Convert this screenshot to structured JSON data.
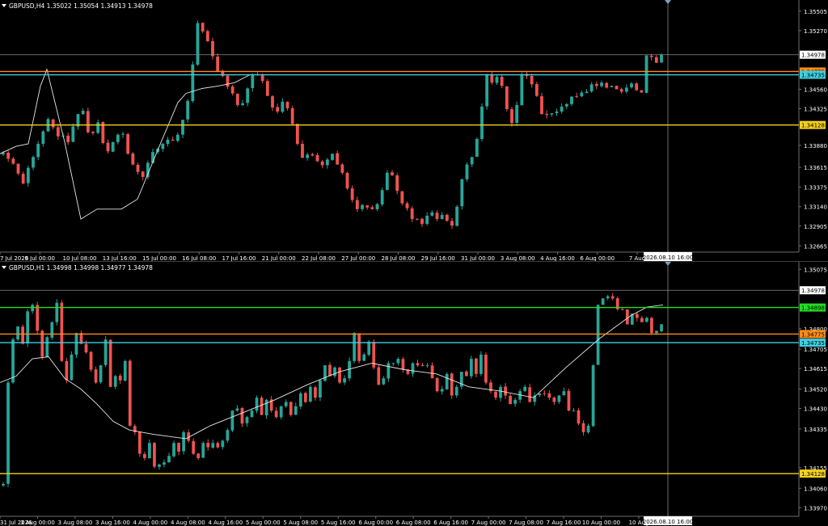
{
  "chart_data": [
    {
      "type": "candlestick",
      "title": "GBPUSD,H4  1.35022 1.35054 1.34913 1.34978",
      "symbol": "GBPUSD",
      "timeframe": "H4",
      "ohlc_readout": [
        "1.35022",
        "1.35054",
        "1.34913",
        "1.34978"
      ],
      "y_ticks": [
        "1.35505",
        "1.35270",
        "1.34560",
        "1.34325",
        "1.33880",
        "1.33615",
        "1.33375",
        "1.33140",
        "1.32905",
        "1.32665"
      ],
      "x_ticks": [
        "7 Jul 2026",
        "9 Jul 00:00",
        "10 Jul 08:00",
        "13 Jul 16:00",
        "15 Jul 00:00",
        "16 Jul 08:00",
        "17 Jul 16:00",
        "21 Jul 00:00",
        "22 Jul 08:00",
        "27 Jul 00:00",
        "28 Jul 08:00",
        "29 Jul 16:00",
        "31 Jul 00:00",
        "3 Aug 08:00",
        "4 Aug 16:00",
        "6 Aug 00:00",
        "7 Aug"
      ],
      "ylim": [
        1.3259,
        1.3564
      ],
      "bar_count": 133,
      "close_series": [
        1.3379,
        1.3372,
        1.3366,
        1.3354,
        1.3342,
        1.3361,
        1.3374,
        1.339,
        1.3405,
        1.342,
        1.341,
        1.3399,
        1.34,
        1.3392,
        1.3411,
        1.3426,
        1.343,
        1.3404,
        1.3403,
        1.3416,
        1.3391,
        1.3381,
        1.3392,
        1.3401,
        1.3402,
        1.3378,
        1.3365,
        1.3356,
        1.335,
        1.3367,
        1.338,
        1.3384,
        1.339,
        1.3395,
        1.3394,
        1.3401,
        1.3419,
        1.3442,
        1.3486,
        1.3536,
        1.3526,
        1.3514,
        1.3496,
        1.3478,
        1.3472,
        1.3459,
        1.3451,
        1.3437,
        1.3439,
        1.3457,
        1.3474,
        1.3473,
        1.3466,
        1.3448,
        1.3434,
        1.3429,
        1.3441,
        1.3433,
        1.3414,
        1.339,
        1.3373,
        1.3377,
        1.3376,
        1.3369,
        1.3364,
        1.3371,
        1.3378,
        1.3365,
        1.3355,
        1.3336,
        1.3322,
        1.3311,
        1.3316,
        1.3313,
        1.3311,
        1.3317,
        1.3334,
        1.3355,
        1.3352,
        1.3333,
        1.3318,
        1.3312,
        1.3299,
        1.3299,
        1.3293,
        1.3303,
        1.3307,
        1.3299,
        1.3304,
        1.3297,
        1.3291,
        1.3314,
        1.3347,
        1.3365,
        1.3374,
        1.3396,
        1.3435,
        1.3474,
        1.3464,
        1.3471,
        1.346,
        1.3432,
        1.3415,
        1.3437,
        1.3474,
        1.3472,
        1.3462,
        1.3448,
        1.3426,
        1.3425,
        1.3427,
        1.3429,
        1.3435,
        1.3438,
        1.3447,
        1.3447,
        1.3452,
        1.3453,
        1.3462,
        1.346,
        1.3464,
        1.3458,
        1.346,
        1.3456,
        1.3453,
        1.3458,
        1.3463,
        1.3455,
        1.3452,
        1.3497,
        1.3495,
        1.3488,
        1.3498
      ],
      "moving_average": [
        [
          0,
          1.3378
        ],
        [
          20,
          1.3387
        ],
        [
          35,
          1.339
        ],
        [
          50,
          1.346
        ],
        [
          58,
          1.348
        ],
        [
          80,
          1.3392
        ],
        [
          100,
          1.3299
        ],
        [
          120,
          1.3311
        ],
        [
          150,
          1.3311
        ],
        [
          170,
          1.3323
        ],
        [
          200,
          1.3394
        ],
        [
          220,
          1.344
        ],
        [
          230,
          1.3451
        ],
        [
          250,
          1.3457
        ],
        [
          270,
          1.346
        ],
        [
          290,
          1.3464
        ],
        [
          310,
          1.3474
        ]
      ],
      "levels": [
        {
          "name": "price-line",
          "value": 1.34978,
          "label": "1.34978",
          "color": "#8a8a8a",
          "label_bg": "#ffffff",
          "label_fg": "#000000"
        },
        {
          "name": "orange-level",
          "value": 1.34775,
          "label": "1.34775",
          "color": "#ff8c1a",
          "label_bg": "#ff8c1a",
          "label_fg": "#000000"
        },
        {
          "name": "cyan-level",
          "value": 1.34735,
          "label": "1.34735",
          "color": "#3ecfe0",
          "label_bg": "#3ecfe0",
          "label_fg": "#000000"
        },
        {
          "name": "yellow-level",
          "value": 1.34128,
          "label": "1.34128",
          "color": "#f2d020",
          "label_bg": "#f2d020",
          "label_fg": "#000000"
        }
      ],
      "crosshair_label": "2026.08.10 16:00"
    },
    {
      "type": "candlestick",
      "title": "GBPUSD,H1  1.34998 1.34998 1.34977 1.34978",
      "symbol": "GBPUSD",
      "timeframe": "H1",
      "ohlc_readout": [
        "1.34998",
        "1.34998",
        "1.34977",
        "1.34978"
      ],
      "y_ticks": [
        "1.35075",
        "1.34800",
        "1.34705",
        "1.34615",
        "1.34520",
        "1.34430",
        "1.34335",
        "1.34155",
        "1.34060",
        "1.33970"
      ],
      "x_ticks": [
        "31 Jul 2026",
        "3 Aug 00:00",
        "3 Aug 08:00",
        "3 Aug 16:00",
        "4 Aug 00:00",
        "4 Aug 08:00",
        "4 Aug 16:00",
        "5 Aug 00:00",
        "5 Aug 08:00",
        "5 Aug 16:00",
        "6 Aug 00:00",
        "6 Aug 08:00",
        "6 Aug 16:00",
        "7 Aug 00:00",
        "7 Aug 08:00",
        "7 Aug 16:00",
        "10 Aug 00:00",
        "10 Aug"
      ],
      "ylim": [
        1.3393,
        1.3511
      ],
      "bar_count": 136,
      "close_series": [
        1.3408,
        1.3455,
        1.3475,
        1.3481,
        1.3473,
        1.3488,
        1.3491,
        1.3479,
        1.3467,
        1.3476,
        1.3483,
        1.3492,
        1.3465,
        1.3456,
        1.3468,
        1.3478,
        1.3473,
        1.3469,
        1.3461,
        1.3455,
        1.3463,
        1.3475,
        1.3453,
        1.3458,
        1.3456,
        1.3465,
        1.3435,
        1.3432,
        1.3422,
        1.342,
        1.3427,
        1.3416,
        1.3417,
        1.3418,
        1.3421,
        1.3427,
        1.3423,
        1.3432,
        1.3428,
        1.3422,
        1.342,
        1.3427,
        1.3425,
        1.3427,
        1.3425,
        1.3428,
        1.3433,
        1.3442,
        1.3443,
        1.3436,
        1.3439,
        1.3442,
        1.3448,
        1.344,
        1.3447,
        1.3442,
        1.3439,
        1.3444,
        1.3446,
        1.344,
        1.3444,
        1.345,
        1.3446,
        1.3453,
        1.3448,
        1.3456,
        1.3463,
        1.3458,
        1.3462,
        1.3455,
        1.3457,
        1.3465,
        1.3478,
        1.3465,
        1.3468,
        1.3474,
        1.3462,
        1.3454,
        1.3457,
        1.3464,
        1.3464,
        1.3466,
        1.3461,
        1.3459,
        1.3464,
        1.3463,
        1.3463,
        1.3463,
        1.3457,
        1.3451,
        1.3452,
        1.3459,
        1.3449,
        1.3453,
        1.346,
        1.3458,
        1.3466,
        1.3459,
        1.3468,
        1.3455,
        1.3451,
        1.3448,
        1.3453,
        1.3449,
        1.3445,
        1.3447,
        1.3451,
        1.3453,
        1.3446,
        1.3449,
        1.345,
        1.345,
        1.3448,
        1.3446,
        1.3449,
        1.3451,
        1.3442,
        1.3442,
        1.3436,
        1.3432,
        1.3435,
        1.3463,
        1.3491,
        1.3494,
        1.3495,
        1.3494,
        1.3489,
        1.3489,
        1.3482,
        1.3487,
        1.3485,
        1.3483,
        1.3485,
        1.3478,
        1.3479,
        1.3482
      ],
      "moving_average": [
        [
          0,
          1.3455
        ],
        [
          20,
          1.3458
        ],
        [
          40,
          1.3466
        ],
        [
          60,
          1.3467
        ],
        [
          80,
          1.3457
        ],
        [
          100,
          1.3452
        ],
        [
          120,
          1.3445
        ],
        [
          140,
          1.3437
        ],
        [
          160,
          1.3433
        ],
        [
          190,
          1.3431
        ],
        [
          230,
          1.3429
        ],
        [
          260,
          1.3435
        ],
        [
          300,
          1.3441
        ],
        [
          340,
          1.3447
        ],
        [
          380,
          1.3454
        ],
        [
          420,
          1.346
        ],
        [
          460,
          1.3464
        ],
        [
          500,
          1.3461
        ],
        [
          540,
          1.3459
        ],
        [
          580,
          1.3453
        ],
        [
          620,
          1.3451
        ],
        [
          660,
          1.3448
        ],
        [
          700,
          1.3462
        ],
        [
          740,
          1.3475
        ],
        [
          780,
          1.3486
        ],
        [
          800,
          1.349
        ],
        [
          820,
          1.3491
        ]
      ],
      "levels": [
        {
          "name": "price-line",
          "value": 1.34978,
          "label": "1.34978",
          "color": "#8a8a8a",
          "label_bg": "#ffffff",
          "label_fg": "#000000"
        },
        {
          "name": "green-level",
          "value": 1.34898,
          "label": "1.34898",
          "color": "#22dd22",
          "label_bg": "#22dd22",
          "label_fg": "#000000"
        },
        {
          "name": "orange-level",
          "value": 1.34775,
          "label": "1.34775",
          "color": "#ff8c1a",
          "label_bg": "#ff8c1a",
          "label_fg": "#000000"
        },
        {
          "name": "cyan-level",
          "value": 1.34735,
          "label": "1.34735",
          "color": "#3ecfe0",
          "label_bg": "#3ecfe0",
          "label_fg": "#000000"
        },
        {
          "name": "yellow-level",
          "value": 1.34128,
          "label": "1.34128",
          "color": "#f2d020",
          "label_bg": "#f2d020",
          "label_fg": "#000000"
        }
      ],
      "crosshair_label": "2026.08.10 16:00"
    }
  ],
  "colors": {
    "bull": "#26a69a",
    "bear": "#ef5350",
    "wick": "#a0a0a0",
    "moving_average": "#e6e6e6",
    "axis": "#6e6e6e",
    "crosshair": "#8c8c8c",
    "background": "#000000"
  }
}
